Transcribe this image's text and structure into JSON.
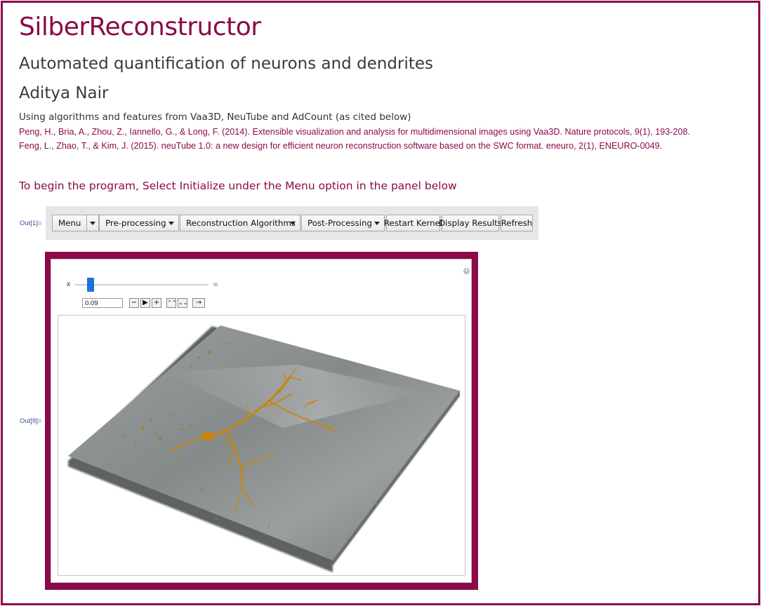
{
  "header": {
    "title": "SilberReconstructor",
    "subtitle": "Automated quantification of neurons and dendrites",
    "author": "Aditya Nair",
    "intro": "Using algorithms and features from Vaa3D, NeuTube and AdCount (as cited below)",
    "citations": [
      "Peng, H., Bria, A., Zhou, Z., Iannello, G., & Long, F. (2014). Extensible visualization and analysis for multidimensional images using Vaa3D. Nature protocols, 9(1), 193-208.",
      "Feng, L., Zhao, T., & Kim, J. (2015). neuTube 1.0: a new design for efficient neuron reconstruction software based on the SWC format. eneuro, 2(1), ENEURO-0049."
    ],
    "instruction": "To begin the program, Select Initialize under the Menu option in the panel below"
  },
  "out_labels": {
    "toolbar": "Out[1]=",
    "panel": "Out[8]="
  },
  "toolbar": {
    "menu": "Menu",
    "preprocessing": "Pre-processing",
    "reconstruction": "Reconstruction Algorithms",
    "postprocessing": "Post-Processing",
    "restart": "Restart Kernel",
    "display": "Display Results",
    "refresh": "Refresh"
  },
  "manipulate": {
    "slider_label": "x",
    "slider_value": "0.09",
    "buttons": [
      "−",
      "▶",
      "+",
      "⌃⌃",
      "⌄⌄",
      "→"
    ]
  },
  "colors": {
    "accent": "#8b0a4a",
    "neuron": "#c8860f",
    "slab": "#7d8282",
    "slider_thumb": "#1a73d6"
  }
}
